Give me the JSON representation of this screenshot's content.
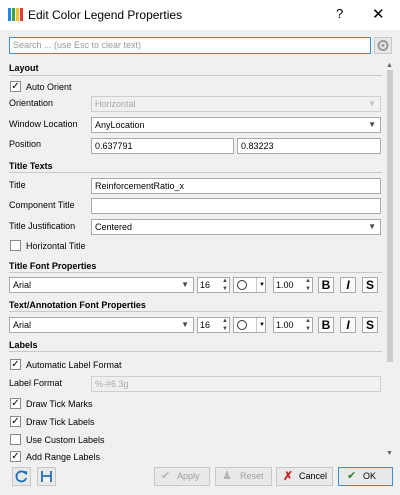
{
  "window": {
    "title": "Edit Color Legend Properties",
    "help": "?",
    "close": "✕"
  },
  "search": {
    "placeholder": "Search ... (use Esc to clear text)"
  },
  "layout": {
    "heading": "Layout",
    "auto_orient_label": "Auto Orient",
    "auto_orient_checked": true,
    "orientation_label": "Orientation",
    "orientation_value": "Horizontal",
    "window_location_label": "Window Location",
    "window_location_value": "AnyLocation",
    "position_label": "Position",
    "position_x": "0.637791",
    "position_y": "0.83223"
  },
  "title_texts": {
    "heading": "Title Texts",
    "title_label": "Title",
    "title_value": "ReinforcementRatio_x",
    "component_title_label": "Component Title",
    "component_title_value": "",
    "justification_label": "Title Justification",
    "justification_value": "Centered",
    "horizontal_title_label": "Horizontal Title",
    "horizontal_title_checked": false
  },
  "title_font": {
    "heading": "Title Font Properties",
    "family": "Arial",
    "size": "16",
    "opacity": "1.00",
    "bold": "B",
    "italic": "I",
    "shadow": "S"
  },
  "annotation_font": {
    "heading": "Text/Annotation Font Properties",
    "family": "Arial",
    "size": "16",
    "opacity": "1.00",
    "bold": "B",
    "italic": "I",
    "shadow": "S"
  },
  "labels": {
    "heading": "Labels",
    "automatic_label_format": "Automatic Label Format",
    "label_format_label": "Label Format",
    "label_format_value": "%-#6.3g",
    "draw_tick_marks": "Draw Tick Marks",
    "draw_tick_labels": "Draw Tick Labels",
    "use_custom_labels": "Use Custom Labels",
    "add_range_labels": "Add Range Labels"
  },
  "buttons": {
    "apply": "Apply",
    "reset": "Reset",
    "cancel": "Cancel",
    "ok": "OK"
  },
  "colors": {
    "accent": "#3c8fd6",
    "cancel_x": "#c62828",
    "ok_check": "#2e7d32"
  }
}
